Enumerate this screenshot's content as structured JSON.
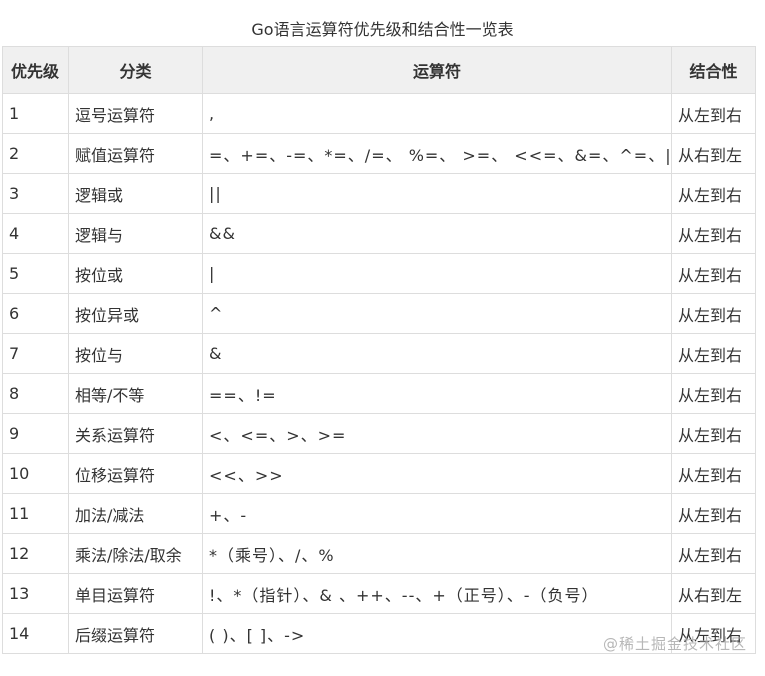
{
  "caption": "Go语言运算符优先级和结合性一览表",
  "headers": {
    "priority": "优先级",
    "category": "分类",
    "operator": "运算符",
    "assoc": "结合性"
  },
  "rows": [
    {
      "priority": "1",
      "category": "逗号运算符",
      "operator": ",",
      "assoc": "从左到右",
      "assoc_rtl": false
    },
    {
      "priority": "2",
      "category": "赋值运算符",
      "operator": "=、+=、-=、*=、/=、 %=、 >=、 <<=、&=、^=、|=",
      "assoc": "从右到左",
      "assoc_rtl": true
    },
    {
      "priority": "3",
      "category": "逻辑或",
      "operator": "||",
      "assoc": "从左到右",
      "assoc_rtl": false
    },
    {
      "priority": "4",
      "category": "逻辑与",
      "operator": "&&",
      "assoc": "从左到右",
      "assoc_rtl": false
    },
    {
      "priority": "5",
      "category": "按位或",
      "operator": "|",
      "assoc": "从左到右",
      "assoc_rtl": false
    },
    {
      "priority": "6",
      "category": "按位异或",
      "operator": "^",
      "assoc": "从左到右",
      "assoc_rtl": false
    },
    {
      "priority": "7",
      "category": "按位与",
      "operator": "&",
      "assoc": "从左到右",
      "assoc_rtl": false
    },
    {
      "priority": "8",
      "category": "相等/不等",
      "operator": "==、!=",
      "assoc": "从左到右",
      "assoc_rtl": false
    },
    {
      "priority": "9",
      "category": "关系运算符",
      "operator": "<、<=、>、>=",
      "assoc": "从左到右",
      "assoc_rtl": false
    },
    {
      "priority": "10",
      "category": "位移运算符",
      "operator": "<<、>>",
      "assoc": "从左到右",
      "assoc_rtl": false
    },
    {
      "priority": "11",
      "category": "加法/减法",
      "operator": "+、-",
      "assoc": "从左到右",
      "assoc_rtl": false
    },
    {
      "priority": "12",
      "category": "乘法/除法/取余",
      "operator": "*（乘号）、/、%",
      "assoc": "从左到右",
      "assoc_rtl": false
    },
    {
      "priority": "13",
      "category": "单目运算符",
      "operator": "!、*（指针）、& 、++、--、+（正号）、-（负号）",
      "assoc": "从右到左",
      "assoc_rtl": true
    },
    {
      "priority": "14",
      "category": "后缀运算符",
      "operator": "( )、[ ]、->",
      "assoc": "从左到右",
      "assoc_rtl": false
    }
  ],
  "colors": {
    "header_bg": "#f0f0f0",
    "border": "#dddddd",
    "text": "#333333",
    "right_to_left": "#c0392b"
  },
  "watermark": "@稀土掘金技术社区"
}
